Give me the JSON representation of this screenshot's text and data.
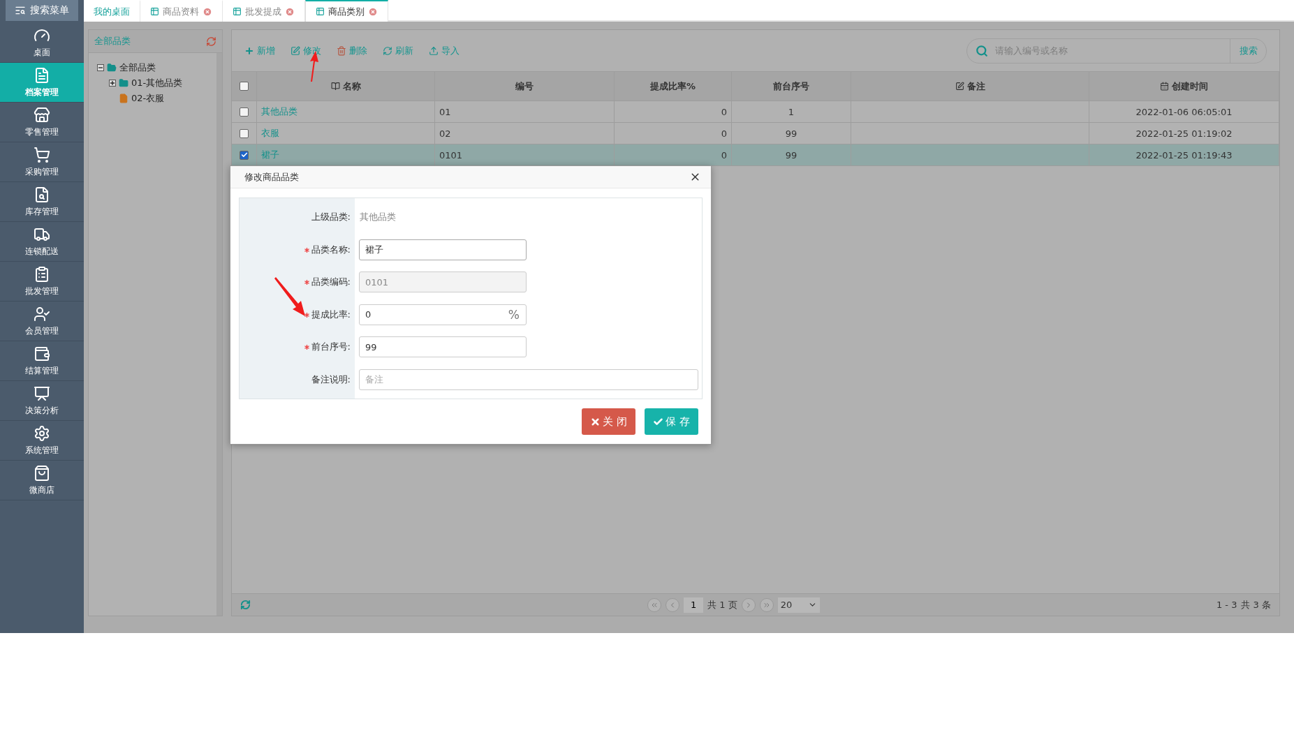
{
  "sidebar": {
    "search_button": "搜索菜单",
    "items": [
      {
        "label": "桌面",
        "kind": "gauge",
        "selected": false
      },
      {
        "label": "档案管理",
        "kind": "archive",
        "selected": true
      },
      {
        "label": "零售管理",
        "kind": "store",
        "selected": false
      },
      {
        "label": "采购管理",
        "kind": "cart",
        "selected": false
      },
      {
        "label": "库存管理",
        "kind": "search",
        "selected": false
      },
      {
        "label": "连锁配送",
        "kind": "truck",
        "selected": false
      },
      {
        "label": "批发管理",
        "kind": "clipboard",
        "selected": false
      },
      {
        "label": "会员管理",
        "kind": "user",
        "selected": false
      },
      {
        "label": "结算管理",
        "kind": "wallet",
        "selected": false
      },
      {
        "label": "决策分析",
        "kind": "chart",
        "selected": false
      },
      {
        "label": "系统管理",
        "kind": "settings",
        "selected": false
      },
      {
        "label": "微商店",
        "kind": "bag",
        "selected": false
      }
    ]
  },
  "tabs": [
    {
      "label": "我的桌面",
      "kind": "home",
      "selected": false
    },
    {
      "label": "商品资料",
      "kind": "page",
      "selected": false
    },
    {
      "label": "批发提成",
      "kind": "page",
      "selected": false
    },
    {
      "label": "商品类别",
      "kind": "page",
      "selected": true
    }
  ],
  "tree": {
    "title": "全部品类",
    "nodes": [
      {
        "label": "全部品类",
        "expanded": true,
        "children": [
          {
            "label": "01-其他品类",
            "expanded": false,
            "kind": "folder"
          },
          {
            "label": "02-衣服",
            "kind": "leaf"
          }
        ]
      }
    ]
  },
  "toolbar": {
    "buttons": [
      {
        "label": "新增",
        "kind": "add"
      },
      {
        "label": "修改",
        "kind": "edit"
      },
      {
        "label": "删除",
        "kind": "delete"
      },
      {
        "label": "刷新",
        "kind": "refresh"
      },
      {
        "label": "导入",
        "kind": "import"
      }
    ],
    "search": {
      "placeholder": "请输入编号或名称",
      "button": "搜索"
    }
  },
  "table": {
    "all_checked": false,
    "columns": [
      {
        "label": "名称",
        "kind": "name"
      },
      {
        "label": "编号",
        "kind": "code"
      },
      {
        "label": "提成比率%",
        "kind": "number"
      },
      {
        "label": "前台序号",
        "kind": "index"
      },
      {
        "label": "备注",
        "kind": "remark"
      },
      {
        "label": "创建时间",
        "kind": "date"
      }
    ],
    "rows": [
      {
        "checked": false,
        "selected": false,
        "cells": [
          "其他品类",
          "01",
          "0",
          "1",
          "",
          "2022-01-06 06:05:01"
        ]
      },
      {
        "checked": false,
        "selected": false,
        "cells": [
          "衣服",
          "02",
          "0",
          "99",
          "",
          "2022-01-25 01:19:02"
        ]
      },
      {
        "checked": true,
        "selected": true,
        "cells": [
          "裙子",
          "0101",
          "0",
          "99",
          "",
          "2022-01-25 01:19:43"
        ]
      }
    ]
  },
  "pager": {
    "page": "1",
    "pages": "共 1 页",
    "page_size": "20",
    "range": "1 - 3",
    "total": "共 3 条"
  },
  "dialog": {
    "title": "修改商品品类",
    "fields": [
      {
        "label": "上级品类:",
        "kind": "static",
        "required": false,
        "value": "其他品类"
      },
      {
        "label": "品类名称:",
        "kind": "text",
        "required": true,
        "value": "裙子"
      },
      {
        "label": "品类编码:",
        "kind": "readonly",
        "required": true,
        "value": "0101"
      },
      {
        "label": "提成比率:",
        "kind": "text",
        "required": true,
        "value": "0",
        "suffix": "%"
      },
      {
        "label": "前台序号:",
        "kind": "text",
        "required": true,
        "value": "99"
      },
      {
        "label": "备注说明:",
        "kind": "wide",
        "required": false,
        "placeholder": "备注"
      }
    ],
    "buttons": [
      {
        "label": "关 闭",
        "kind": "close"
      },
      {
        "label": "保 存",
        "kind": "save"
      }
    ]
  }
}
